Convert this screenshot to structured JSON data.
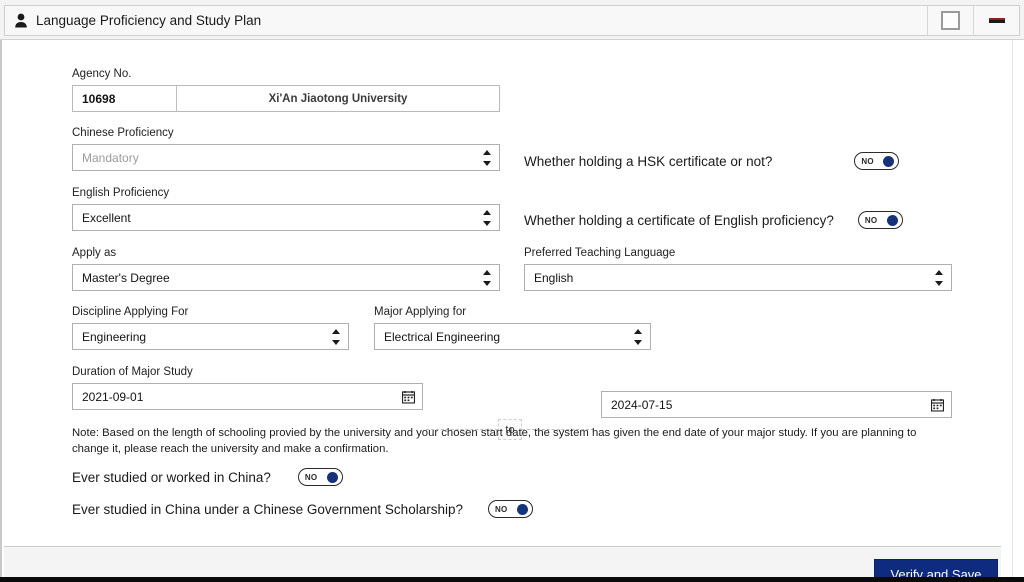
{
  "window": {
    "title": "Language Proficiency and Study Plan",
    "title_icon": "user-icon",
    "maximize_label": "",
    "minimize_label": ""
  },
  "form": {
    "agency": {
      "label": "Agency No.",
      "code": "10698",
      "name": "Xi'An Jiaotong University"
    },
    "chinese_proficiency": {
      "label": "Chinese Proficiency",
      "value": "Mandatory",
      "is_placeholder": true
    },
    "english_proficiency": {
      "label": "English Proficiency",
      "value": "Excellent",
      "is_placeholder": false
    },
    "apply_as": {
      "label": "Apply as",
      "value": "Master's Degree"
    },
    "preferred_teaching_language": {
      "label": "Preferred Teaching Language",
      "value": "English"
    },
    "discipline": {
      "label": "Discipline Applying For",
      "value": "Engineering"
    },
    "major": {
      "label": "Major Applying for",
      "value": "Electrical Engineering"
    },
    "duration": {
      "label": "Duration of Major Study",
      "start_date": "2021-09-01",
      "end_date": "2024-07-15",
      "separator": "to",
      "calendar_icon": "calendar-icon"
    },
    "note": "Note: Based on the length of schooling provied by the university and your chosen start date, the system has given the end date of your major study. If you are planning to change it, please reach the university and make a confirmation."
  },
  "questions": {
    "hsk_certificate": {
      "text": "Whether holding a HSK certificate or not?",
      "toggle_value": "NO"
    },
    "english_certificate": {
      "text": "Whether holding a certificate of English proficiency?",
      "toggle_value": "NO"
    },
    "studied_worked_china": {
      "text": "Ever studied or worked in China?",
      "toggle_value": "NO"
    },
    "scholarship_china": {
      "text": "Ever studied in China under a Chinese Government Scholarship?",
      "toggle_value": "NO"
    }
  },
  "footer": {
    "save_label": "Verify and Save"
  },
  "colors": {
    "accent": "#0f2b80",
    "toggle_knob": "#16337a",
    "titlebar": "#f8f8f8"
  }
}
